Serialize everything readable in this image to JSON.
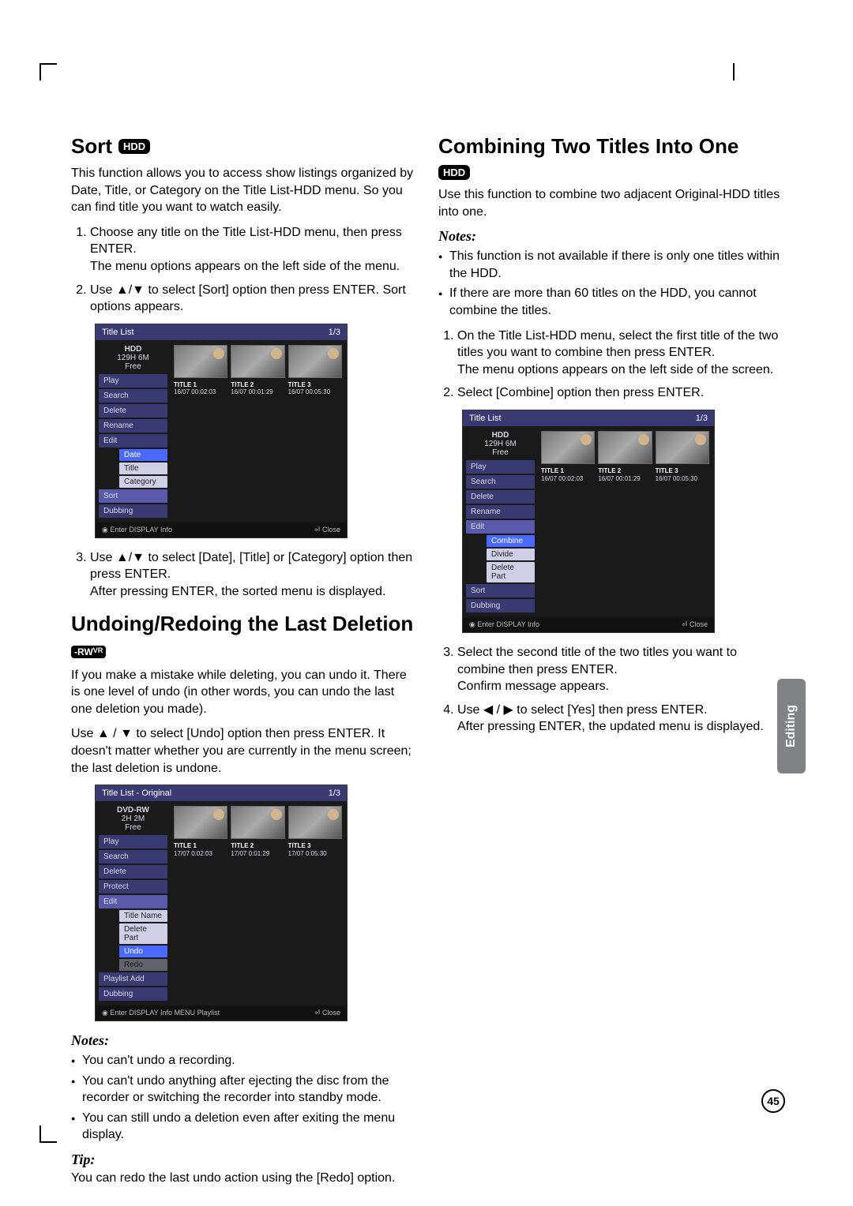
{
  "page_number": "45",
  "side_tab": "Editing",
  "left": {
    "sort": {
      "heading": "Sort",
      "badge": "HDD",
      "intro": "This function allows you to access show listings organized by Date, Title, or Category on the Title List-HDD menu. So you can find title you want to watch easily.",
      "steps": {
        "s1a": "Choose any title on the Title List-HDD menu, then press ENTER.",
        "s1b": "The menu options appears on the left side of the menu.",
        "s2": "Use ▲/▼ to select [Sort] option then press ENTER. Sort options appears.",
        "s3a": "Use ▲/▼ to select [Date], [Title] or [Category] option then press ENTER.",
        "s3b": "After pressing ENTER, the sorted menu is displayed."
      }
    },
    "undo": {
      "heading": "Undoing/Redoing the Last Deletion",
      "badge_main": "-RW",
      "badge_sub": "VR",
      "p1": "If you make a mistake while deleting, you can undo it. There is one level of undo (in other words, you can undo the last one deletion you made).",
      "p2": "Use ▲ / ▼ to select [Undo] option then press ENTER. It doesn't matter whether you are currently in the menu screen; the last deletion is undone.",
      "notes_h": "Notes:",
      "notes": {
        "n1": "You can't undo a recording.",
        "n2": "You can't undo anything after ejecting the disc from the recorder or switching the recorder into standby mode.",
        "n3": "You can still undo a deletion even after exiting the menu display."
      },
      "tip_h": "Tip:",
      "tip": "You can redo the last undo action using the [Redo] option."
    },
    "shot1": {
      "header": "Title List",
      "page": "1/3",
      "media": "HDD",
      "size": "129H 6M",
      "free": "Free",
      "menu": {
        "m1": "Play",
        "m2": "Search",
        "m3": "Delete",
        "m4": "Rename",
        "m5": "Edit",
        "m6": "Sort",
        "m7": "Dubbing"
      },
      "sub": {
        "s1": "Date",
        "s2": "Title",
        "s3": "Category"
      },
      "thumbs": {
        "t1": {
          "title": "TITLE 1",
          "meta": "16/07   00:02:03"
        },
        "t2": {
          "title": "TITLE 2",
          "meta": "16/07   00:01:29"
        },
        "t3": {
          "title": "TITLE 3",
          "meta": "16/07   00:05:30"
        }
      },
      "footer_l": "◉ Enter  DISPLAY Info",
      "footer_r": "⏎ Close"
    },
    "shot2": {
      "header": "Title List - Original",
      "page": "1/3",
      "media": "DVD-RW",
      "size": "2H 2M",
      "free": "Free",
      "menu": {
        "m1": "Play",
        "m2": "Search",
        "m3": "Delete",
        "m4": "Protect",
        "m5": "Edit",
        "m6": "Playlist Add",
        "m7": "Dubbing"
      },
      "sub": {
        "s1": "Title Name",
        "s2": "Delete Part",
        "s3": "Undo",
        "s4": "Redo"
      },
      "thumbs": {
        "t1": {
          "title": "TITLE 1",
          "meta": "17/07   0:02:03"
        },
        "t2": {
          "title": "TITLE 2",
          "meta": "17/07   0:01:29"
        },
        "t3": {
          "title": "TITLE 3",
          "meta": "17/07   0:05:30"
        }
      },
      "footer_l": "◉ Enter  DISPLAY Info  MENU Playlist",
      "footer_r": "⏎ Close"
    }
  },
  "right": {
    "combine": {
      "heading": "Combining Two Titles Into One",
      "badge": "HDD",
      "intro": "Use this function to combine two adjacent Original-HDD titles into one.",
      "notes_h": "Notes:",
      "notes": {
        "n1": "This function is not available if there is only one titles within the HDD.",
        "n2": "If there are more than 60 titles on the HDD, you cannot combine the titles."
      },
      "steps": {
        "s1a": "On the Title List-HDD menu, select the first title of the two titles you want to combine then press ENTER.",
        "s1b": "The menu options appears on the left side of the screen.",
        "s2": "Select [Combine] option then press ENTER.",
        "s3a": "Select the second title of the two titles you want to combine then press ENTER.",
        "s3b": "Confirm message appears.",
        "s4a": "Use ◀ / ▶ to select [Yes] then press ENTER.",
        "s4b": "After pressing ENTER, the updated menu is displayed."
      }
    },
    "shot3": {
      "header": "Title List",
      "page": "1/3",
      "media": "HDD",
      "size": "129H 6M",
      "free": "Free",
      "menu": {
        "m1": "Play",
        "m2": "Search",
        "m3": "Delete",
        "m4": "Rename",
        "m5": "Edit",
        "m6": "Sort",
        "m7": "Dubbing"
      },
      "sub": {
        "s1": "Combine",
        "s2": "Divide",
        "s3": "Delete Part"
      },
      "thumbs": {
        "t1": {
          "title": "TITLE 1",
          "meta": "16/07   00:02:03"
        },
        "t2": {
          "title": "TITLE 2",
          "meta": "16/07   00:01:29"
        },
        "t3": {
          "title": "TITLE 3",
          "meta": "16/07   00:05:30"
        }
      },
      "footer_l": "◉ Enter  DISPLAY Info",
      "footer_r": "⏎ Close"
    }
  }
}
